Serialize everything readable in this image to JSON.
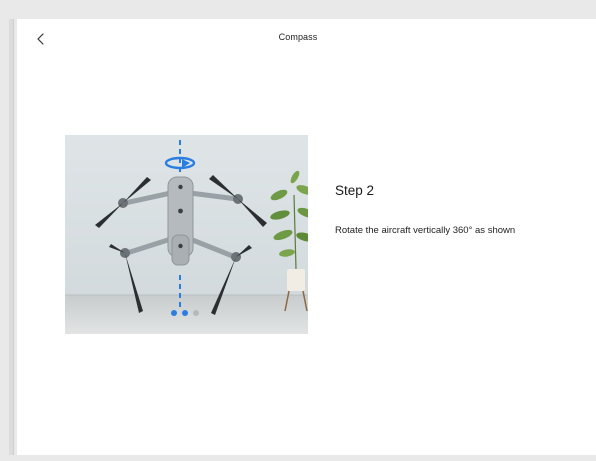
{
  "header": {
    "title": "Compass"
  },
  "step": {
    "title": "Step 2",
    "description": "Rotate the aircraft vertically 360° as shown"
  },
  "pager": {
    "total": 3,
    "active_index": 1,
    "colors": [
      "#2a7de1",
      "#2a7de1",
      "#b8b8b8"
    ]
  },
  "theme": {
    "accent": "#2a7de1",
    "background": "#ffffff"
  },
  "icons": {
    "back": "chevron-left-icon",
    "rotate": "rotate-arrow-icon"
  }
}
